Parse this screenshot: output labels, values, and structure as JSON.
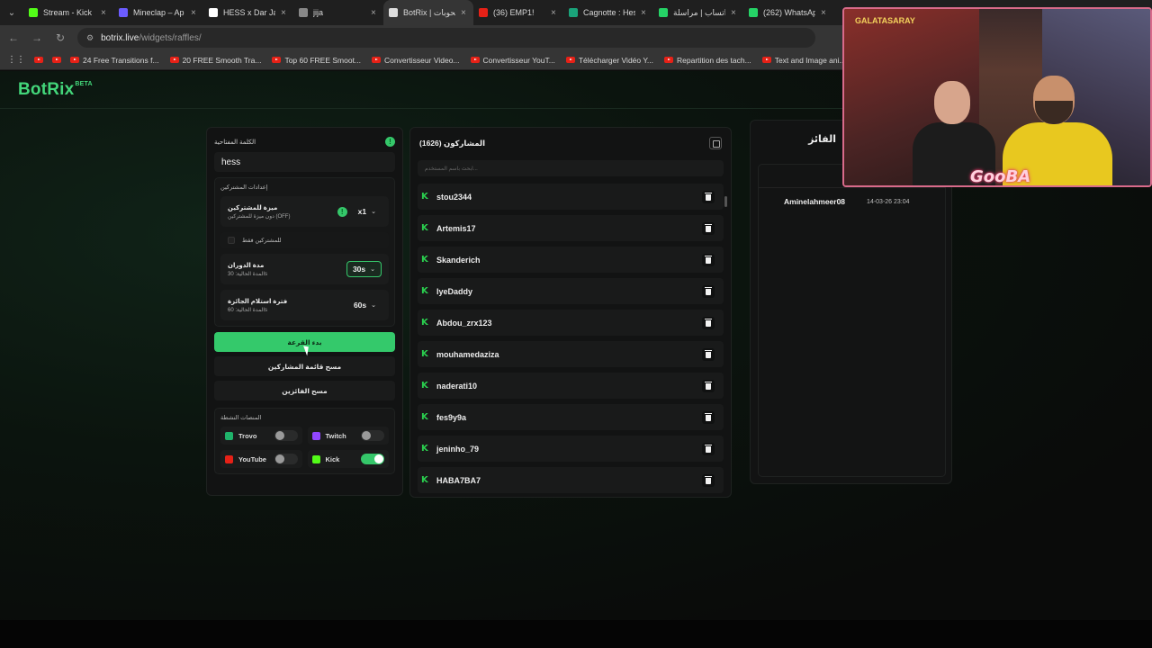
{
  "browser": {
    "tabs": [
      {
        "label": "Stream - Kick",
        "color": "#53fc18",
        "active": false
      },
      {
        "label": "Mineclap – Ap",
        "color": "#6b5cff",
        "active": false
      },
      {
        "label": "HESS x Dar Jam",
        "color": "#ffffff",
        "active": false
      },
      {
        "label": "jija",
        "color": "#888888",
        "active": false
      },
      {
        "label": "BotRix | سحوبات",
        "color": "#dddddd",
        "active": true
      },
      {
        "label": "(36) EMP1!",
        "color": "#e62117",
        "active": false
      },
      {
        "label": "Cagnotte : Hes",
        "color": "#1aa37a",
        "active": false
      },
      {
        "label": "واتساب | مراسلة",
        "color": "#25d366",
        "active": false
      },
      {
        "label": "(262) WhatsAp",
        "color": "#25d366",
        "active": false
      }
    ],
    "url_host": "botrix.live",
    "url_path": "/widgets/raffles/",
    "bookmarks": [
      "24 Free Transitions f...",
      "20 FREE Smooth Tra...",
      "Top 60 FREE Smoot...",
      "Convertisseur Video...",
      "Convertisseur YouT...",
      "Télécharger Vidéo Y...",
      "Repartition des tach...",
      "Text and Image ani..."
    ]
  },
  "app": {
    "logo": "BotRix",
    "logo_badge": "BETA"
  },
  "settings": {
    "keyword_label": "الكلمة المفتاحية",
    "keyword_value": "hess",
    "participant_settings_title": "إعدادات المشتركين",
    "subscriber_bonus_title": "ميزة للمشتركين",
    "subscriber_bonus_sub": "دون ميزة للمشتركين (OFF)",
    "subscriber_bonus_value": "x1",
    "subscribers_only": "للمشتركين فقط",
    "spin_duration_title": "مدة الدوران",
    "spin_duration_sub": "المدة الحالية: 30s",
    "spin_duration_value": "30s",
    "claim_time_title": "فترة استلام الجائزة",
    "claim_time_sub": "المدة الحالية: 60s",
    "claim_time_value": "60s",
    "start_button": "بدء القرعة",
    "clear_participants_button": "مسح قائمة المشاركين",
    "clear_winners_button": "مسح الفائزين",
    "platforms_title": "المنصات النشطة",
    "platforms": [
      {
        "name": "Trovo",
        "color": "#1fb36a",
        "on": false
      },
      {
        "name": "Twitch",
        "color": "#9146ff",
        "on": false
      },
      {
        "name": "YouTube",
        "color": "#e62117",
        "on": false
      },
      {
        "name": "Kick",
        "color": "#53fc18",
        "on": true
      }
    ]
  },
  "participants": {
    "title": "المشاركون (1626)",
    "search_placeholder": "ابحث باسم المستخدم...",
    "list": [
      "stou2344",
      "Artemis17",
      "Skanderich",
      "IyeDaddy",
      "Abdou_zrx123",
      "mouhamedaziza",
      "naderati10",
      "fes9y9a",
      "jeninho_79",
      "HABA7BA7"
    ]
  },
  "winners": {
    "title": "الفائز",
    "list": [
      {
        "name": "Aminelahmeer08",
        "time": "14-03-26 23:04"
      }
    ]
  },
  "overlay": {
    "label": "GooBA",
    "jersey": "GALATASARAY"
  },
  "colors": {
    "accent": "#34c96b",
    "kick": "#2ad04f"
  }
}
